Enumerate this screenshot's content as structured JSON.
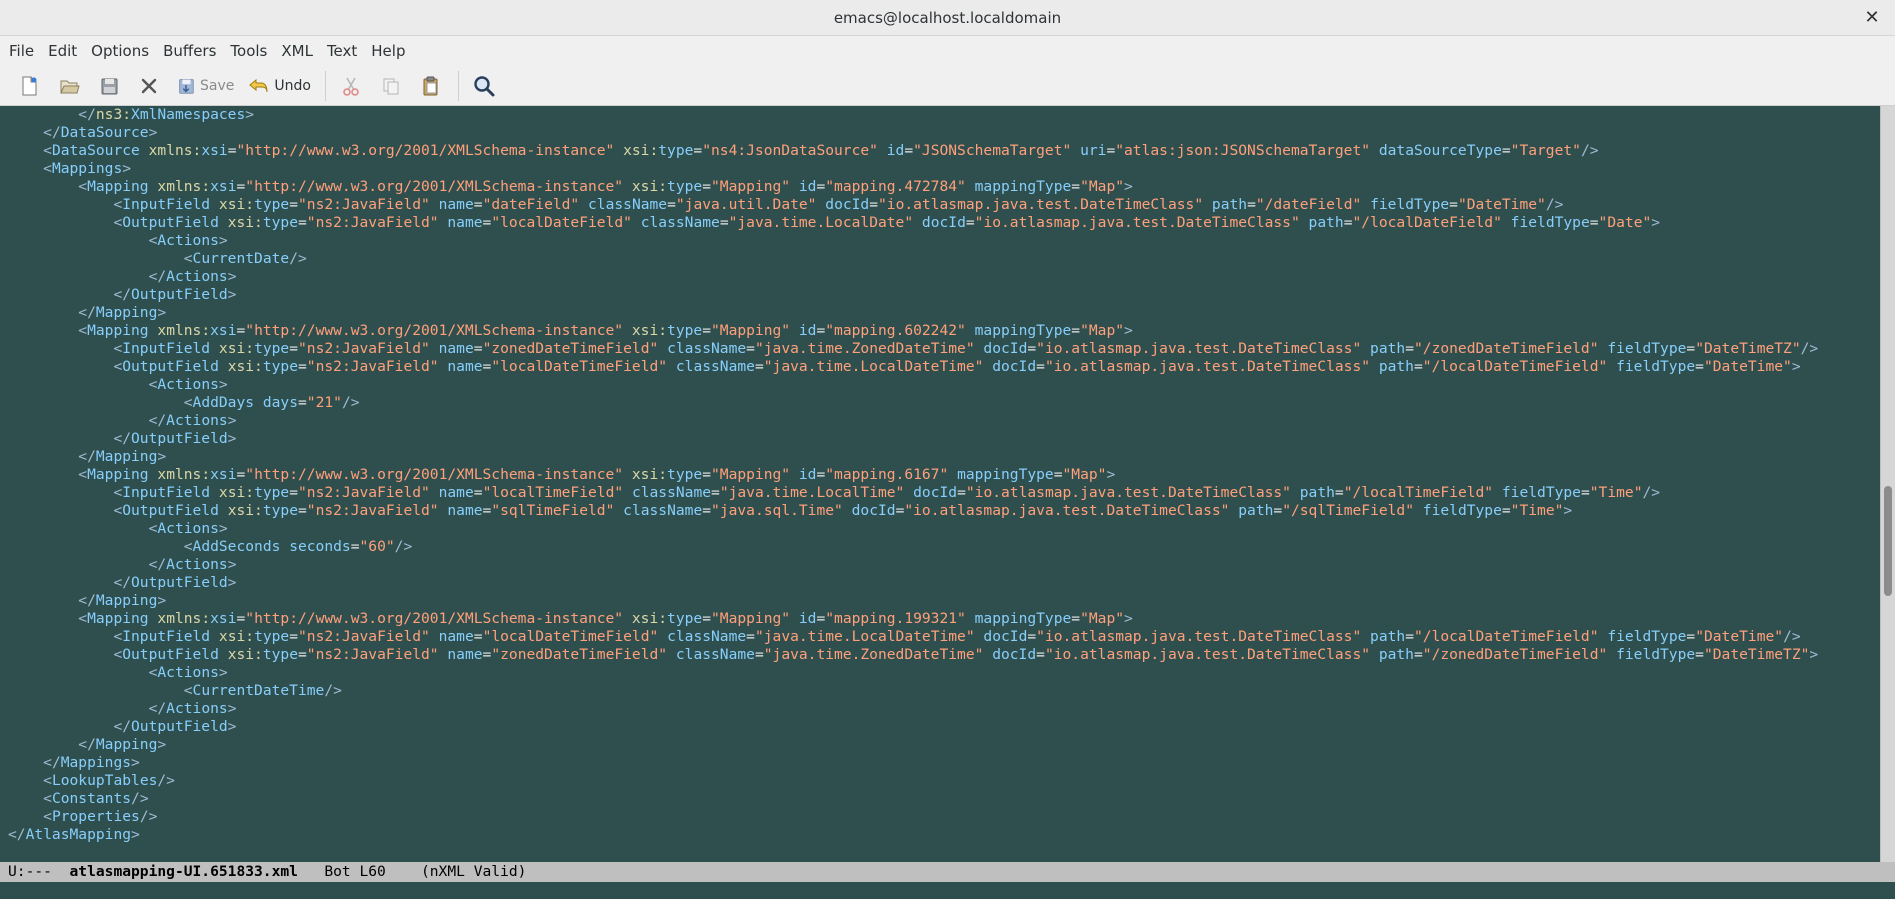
{
  "window": {
    "title": "emacs@localhost.localdomain",
    "close_glyph": "✕"
  },
  "menubar": [
    "File",
    "Edit",
    "Options",
    "Buffers",
    "Tools",
    "XML",
    "Text",
    "Help"
  ],
  "toolbar": {
    "new_file": "new-file-icon",
    "open": "open-folder-icon",
    "save_icon": "save-icon",
    "close": "close-buffer-icon",
    "save_label": "Save",
    "undo_label": "Undo",
    "cut": "cut-icon",
    "copy": "copy-icon",
    "paste": "paste-icon",
    "search": "search-icon"
  },
  "colors": {
    "background": "#2f4f4f",
    "tag": "#87cefa",
    "value": "#ffa07a",
    "bracket": "#9fbbd3",
    "modeline": "#bfbfbf"
  },
  "lines": [
    "        </ns3:XmlNamespaces>",
    "    </DataSource>",
    "    <DataSource xmlns:xsi=\"http://www.w3.org/2001/XMLSchema-instance\" xsi:type=\"ns4:JsonDataSource\" id=\"JSONSchemaTarget\" uri=\"atlas:json:JSONSchemaTarget\" dataSourceType=\"Target\"/>",
    "    <Mappings>",
    "        <Mapping xmlns:xsi=\"http://www.w3.org/2001/XMLSchema-instance\" xsi:type=\"Mapping\" id=\"mapping.472784\" mappingType=\"Map\">",
    "            <InputField xsi:type=\"ns2:JavaField\" name=\"dateField\" className=\"java.util.Date\" docId=\"io.atlasmap.java.test.DateTimeClass\" path=\"/dateField\" fieldType=\"DateTime\"/>",
    "            <OutputField xsi:type=\"ns2:JavaField\" name=\"localDateField\" className=\"java.time.LocalDate\" docId=\"io.atlasmap.java.test.DateTimeClass\" path=\"/localDateField\" fieldType=\"Date\">",
    "                <Actions>",
    "                    <CurrentDate/>",
    "                </Actions>",
    "            </OutputField>",
    "        </Mapping>",
    "        <Mapping xmlns:xsi=\"http://www.w3.org/2001/XMLSchema-instance\" xsi:type=\"Mapping\" id=\"mapping.602242\" mappingType=\"Map\">",
    "            <InputField xsi:type=\"ns2:JavaField\" name=\"zonedDateTimeField\" className=\"java.time.ZonedDateTime\" docId=\"io.atlasmap.java.test.DateTimeClass\" path=\"/zonedDateTimeField\" fieldType=\"DateTimeTZ\"/>",
    "            <OutputField xsi:type=\"ns2:JavaField\" name=\"localDateTimeField\" className=\"java.time.LocalDateTime\" docId=\"io.atlasmap.java.test.DateTimeClass\" path=\"/localDateTimeField\" fieldType=\"DateTime\">",
    "                <Actions>",
    "                    <AddDays days=\"21\"/>",
    "                </Actions>",
    "            </OutputField>",
    "        </Mapping>",
    "        <Mapping xmlns:xsi=\"http://www.w3.org/2001/XMLSchema-instance\" xsi:type=\"Mapping\" id=\"mapping.6167\" mappingType=\"Map\">",
    "            <InputField xsi:type=\"ns2:JavaField\" name=\"localTimeField\" className=\"java.time.LocalTime\" docId=\"io.atlasmap.java.test.DateTimeClass\" path=\"/localTimeField\" fieldType=\"Time\"/>",
    "            <OutputField xsi:type=\"ns2:JavaField\" name=\"sqlTimeField\" className=\"java.sql.Time\" docId=\"io.atlasmap.java.test.DateTimeClass\" path=\"/sqlTimeField\" fieldType=\"Time\">",
    "                <Actions>",
    "                    <AddSeconds seconds=\"60\"/>",
    "                </Actions>",
    "            </OutputField>",
    "        </Mapping>",
    "        <Mapping xmlns:xsi=\"http://www.w3.org/2001/XMLSchema-instance\" xsi:type=\"Mapping\" id=\"mapping.199321\" mappingType=\"Map\">",
    "            <InputField xsi:type=\"ns2:JavaField\" name=\"localDateTimeField\" className=\"java.time.LocalDateTime\" docId=\"io.atlasmap.java.test.DateTimeClass\" path=\"/localDateTimeField\" fieldType=\"DateTime\"/>",
    "            <OutputField xsi:type=\"ns2:JavaField\" name=\"zonedDateTimeField\" className=\"java.time.ZonedDateTime\" docId=\"io.atlasmap.java.test.DateTimeClass\" path=\"/zonedDateTimeField\" fieldType=\"DateTimeTZ\">",
    "                <Actions>",
    "                    <CurrentDateTime/>",
    "                </Actions>",
    "            </OutputField>",
    "        </Mapping>",
    "    </Mappings>",
    "    <LookupTables/>",
    "    <Constants/>",
    "    <Properties/>",
    "</AtlasMapping>"
  ],
  "modeline": {
    "status": "U:---  ",
    "buffer": "atlasmapping-UI.651833.xml",
    "position": "   Bot L60    ",
    "mode": "(nXML Valid)"
  }
}
